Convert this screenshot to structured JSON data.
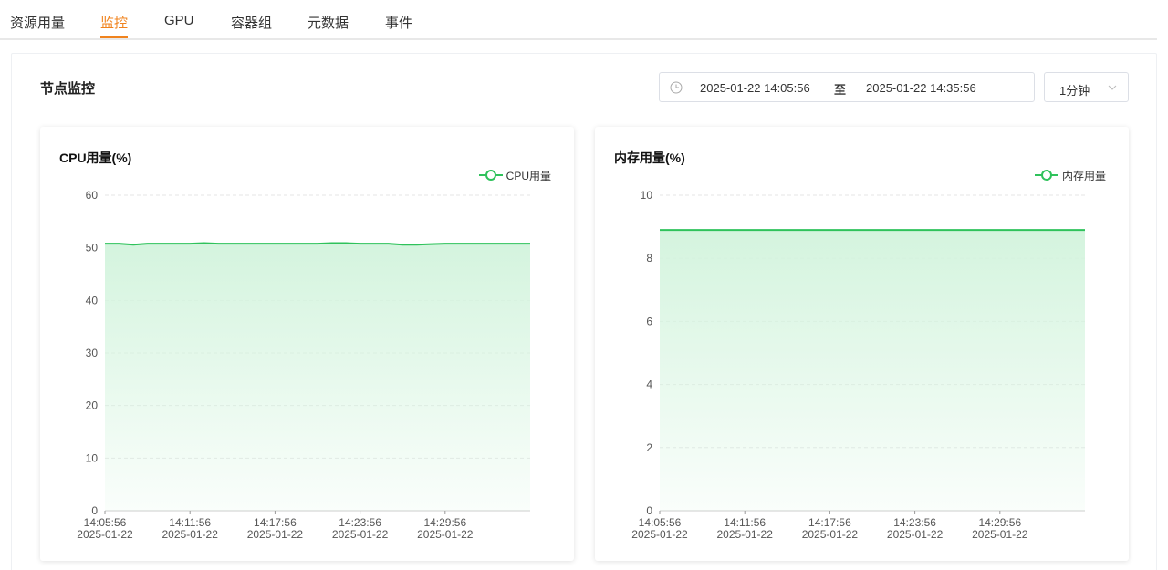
{
  "tabs": [
    {
      "label": "资源用量"
    },
    {
      "label": "监控",
      "active": true
    },
    {
      "label": "GPU"
    },
    {
      "label": "容器组"
    },
    {
      "label": "元数据"
    },
    {
      "label": "事件"
    }
  ],
  "section": {
    "title": "节点监控"
  },
  "date_range": {
    "start": "2025-01-22 14:05:56",
    "separator": "至",
    "end": "2025-01-22 14:35:56",
    "icon": "clock-icon"
  },
  "interval": {
    "value": "1分钟",
    "icon": "chevron-down-icon"
  },
  "colors": {
    "accent": "#f0831e",
    "series": "#2fc25b",
    "area_top": "#d4f4de",
    "grid": "#e6e6e6"
  },
  "chart_data": [
    {
      "type": "area",
      "title": "CPU用量(%)",
      "legend_position": "top-right",
      "grid": true,
      "ylim": [
        0,
        60
      ],
      "yticks": [
        0,
        10,
        20,
        30,
        40,
        50,
        60
      ],
      "xticks": [
        {
          "time": "14:05:56",
          "date": "2025-01-22"
        },
        {
          "time": "14:11:56",
          "date": "2025-01-22"
        },
        {
          "time": "14:17:56",
          "date": "2025-01-22"
        },
        {
          "time": "14:23:56",
          "date": "2025-01-22"
        },
        {
          "time": "14:29:56",
          "date": "2025-01-22"
        }
      ],
      "x": [
        "14:05:56",
        "14:06:56",
        "14:07:56",
        "14:08:56",
        "14:09:56",
        "14:10:56",
        "14:11:56",
        "14:12:56",
        "14:13:56",
        "14:14:56",
        "14:15:56",
        "14:16:56",
        "14:17:56",
        "14:18:56",
        "14:19:56",
        "14:20:56",
        "14:21:56",
        "14:22:56",
        "14:23:56",
        "14:24:56",
        "14:25:56",
        "14:26:56",
        "14:27:56",
        "14:28:56",
        "14:29:56",
        "14:30:56",
        "14:31:56",
        "14:32:56",
        "14:33:56",
        "14:34:56",
        "14:35:56"
      ],
      "series": [
        {
          "name": "CPU用量",
          "values": [
            50.8,
            50.8,
            50.6,
            50.8,
            50.8,
            50.8,
            50.8,
            50.9,
            50.8,
            50.8,
            50.8,
            50.8,
            50.8,
            50.8,
            50.8,
            50.8,
            50.9,
            50.9,
            50.8,
            50.8,
            50.8,
            50.6,
            50.6,
            50.7,
            50.8,
            50.8,
            50.8,
            50.8,
            50.8,
            50.8,
            50.8
          ]
        }
      ]
    },
    {
      "type": "area",
      "title": "内存用量(%)",
      "legend_position": "top-right",
      "grid": true,
      "ylim": [
        0,
        10
      ],
      "yticks": [
        0,
        2,
        4,
        6,
        8,
        10
      ],
      "xticks": [
        {
          "time": "14:05:56",
          "date": "2025-01-22"
        },
        {
          "time": "14:11:56",
          "date": "2025-01-22"
        },
        {
          "time": "14:17:56",
          "date": "2025-01-22"
        },
        {
          "time": "14:23:56",
          "date": "2025-01-22"
        },
        {
          "time": "14:29:56",
          "date": "2025-01-22"
        }
      ],
      "x": [
        "14:05:56",
        "14:06:56",
        "14:07:56",
        "14:08:56",
        "14:09:56",
        "14:10:56",
        "14:11:56",
        "14:12:56",
        "14:13:56",
        "14:14:56",
        "14:15:56",
        "14:16:56",
        "14:17:56",
        "14:18:56",
        "14:19:56",
        "14:20:56",
        "14:21:56",
        "14:22:56",
        "14:23:56",
        "14:24:56",
        "14:25:56",
        "14:26:56",
        "14:27:56",
        "14:28:56",
        "14:29:56",
        "14:30:56",
        "14:31:56",
        "14:32:56",
        "14:33:56",
        "14:34:56",
        "14:35:56"
      ],
      "series": [
        {
          "name": "内存用量",
          "values": [
            8.9,
            8.9,
            8.9,
            8.9,
            8.9,
            8.9,
            8.9,
            8.9,
            8.9,
            8.9,
            8.9,
            8.9,
            8.9,
            8.9,
            8.9,
            8.9,
            8.9,
            8.9,
            8.9,
            8.9,
            8.9,
            8.9,
            8.9,
            8.9,
            8.9,
            8.9,
            8.9,
            8.9,
            8.9,
            8.9,
            8.9
          ]
        }
      ]
    }
  ]
}
